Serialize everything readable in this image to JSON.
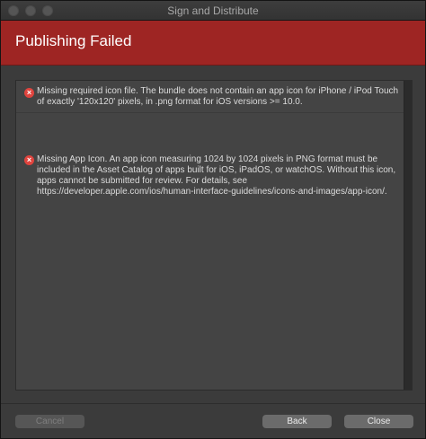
{
  "window": {
    "title": "Sign and Distribute"
  },
  "banner": {
    "title": "Publishing Failed",
    "color": "#9e2523"
  },
  "messages": [
    {
      "icon": "error-icon",
      "text": "Missing required icon file. The bundle does not contain an app icon for iPhone / iPod Touch of exactly '120x120' pixels, in .png format for iOS versions >= 10.0."
    },
    {
      "icon": "error-icon",
      "text": "Missing App Icon. An app icon measuring 1024 by 1024 pixels in PNG format must be included in the Asset Catalog of apps built for iOS, iPadOS, or watchOS. Without this icon, apps cannot be submitted for review. For details, see https://developer.apple.com/ios/human-interface-guidelines/icons-and-images/app-icon/."
    }
  ],
  "footer": {
    "cancel_label": "Cancel",
    "back_label": "Back",
    "close_label": "Close"
  }
}
